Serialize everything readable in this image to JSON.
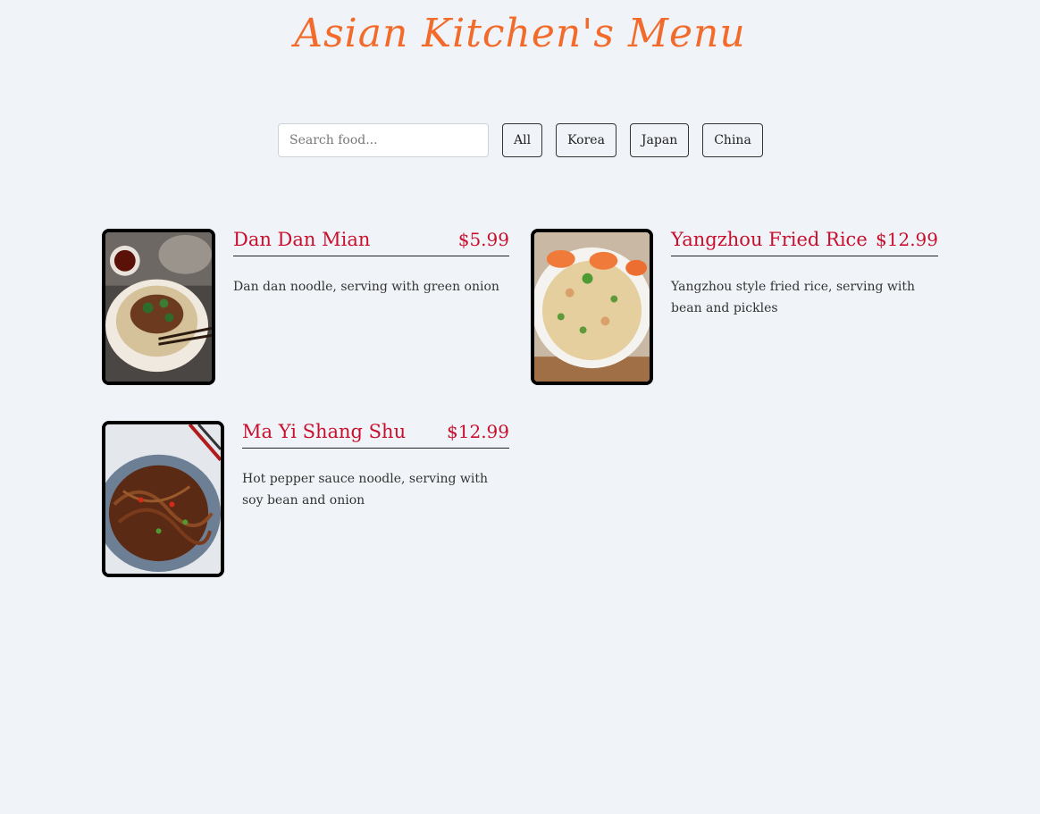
{
  "header": {
    "title": "Asian Kitchen's Menu"
  },
  "search": {
    "placeholder": "Search food..."
  },
  "filters": [
    "All",
    "Korea",
    "Japan",
    "China"
  ],
  "menu": [
    {
      "name": "Dan Dan Mian",
      "price": "$5.99",
      "description": "Dan dan noodle, serving with green onion",
      "image": "dan-dan-noodle-photo"
    },
    {
      "name": "Yangzhou Fried Rice",
      "price": "$12.99",
      "description": "Yangzhou style fried rice, serving with bean and pickles",
      "image": "fried-rice-photo"
    },
    {
      "name": "Ma Yi Shang Shu",
      "price": "$12.99",
      "description": "Hot pepper sauce noodle, serving with soy bean and onion",
      "image": "glass-noodle-photo"
    }
  ],
  "colors": {
    "background": "#f0f4f8",
    "title": "#f26b2b",
    "accent": "#c8102e"
  }
}
